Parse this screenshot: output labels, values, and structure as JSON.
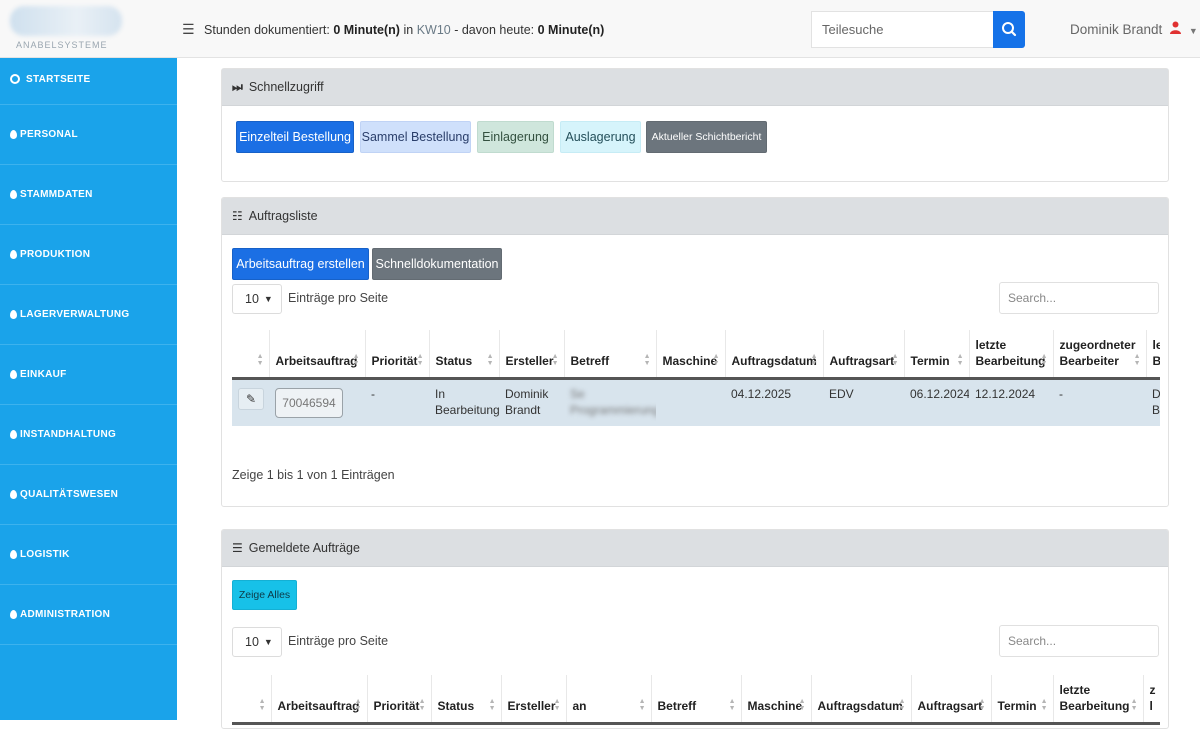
{
  "header": {
    "logo_text": "ANABELSYSTEME",
    "hours_prefix": "Stunden dokumentiert:",
    "hours_value": "0 Minute(n)",
    "hours_in": "in",
    "week": "KW10",
    "today_prefix": "- davon heute:",
    "today_value": "0 Minute(n)",
    "part_search_placeholder": "Teilesuche",
    "user_name": "Dominik Brandt"
  },
  "sidebar": {
    "items": [
      {
        "label": "STARTSEITE"
      },
      {
        "label": "PERSONAL"
      },
      {
        "label": "STAMMDATEN"
      },
      {
        "label": "PRODUKTION"
      },
      {
        "label": "LAGERVERWALTUNG"
      },
      {
        "label": "EINKAUF"
      },
      {
        "label": "INSTANDHALTUNG"
      },
      {
        "label": "QUALITÄTSWESEN"
      },
      {
        "label": "LOGISTIK"
      },
      {
        "label": "ADMINISTRATION"
      }
    ]
  },
  "quick_access": {
    "title": "Schnellzugriff",
    "buttons": [
      "Einzelteil Bestellung",
      "Sammel Bestellung",
      "Einlagerung",
      "Auslagerung",
      "Aktueller Schichtbericht"
    ]
  },
  "order_list": {
    "title": "Auftragsliste",
    "create_button": "Arbeitsauftrag erstellen",
    "quick_doc_button": "Schnelldokumentation",
    "page_length": "10",
    "page_length_label": "Einträge pro Seite",
    "search_placeholder": "Search...",
    "columns": [
      "Arbeitsauftrag",
      "Priorität",
      "Status",
      "Ersteller",
      "Betreff",
      "Maschine",
      "Auftragsdatum",
      "Auftragsart",
      "Termin",
      "letzte Bearbeitung",
      "zugeordneter Bearbeiter",
      "le B"
    ],
    "row": {
      "order_no": "70046594",
      "priority": "-",
      "status_line1": "In",
      "status_line2": "Bearbeitung",
      "creator_line1": "Dominik",
      "creator_line2": "Brandt",
      "subject_line1": "Se",
      "subject_line2": "Programmierung",
      "machine": "",
      "order_date": "04.12.2025",
      "order_type": "EDV",
      "due_date": "06.12.2024",
      "last_edit": "12.12.2024",
      "assignee": "-",
      "extra_line1": "D",
      "extra_line2": "B"
    },
    "info": "Zeige 1 bis 1 von 1 Einträgen"
  },
  "reported_orders": {
    "title": "Gemeldete Aufträge",
    "show_all_button": "Zeige Alles",
    "page_length": "10",
    "page_length_label": "Einträge pro Seite",
    "search_placeholder": "Search...",
    "columns": [
      "Arbeitsauftrag",
      "Priorität",
      "Status",
      "Ersteller",
      "an",
      "Betreff",
      "Maschine",
      "Auftragsdatum",
      "Auftragsart",
      "Termin",
      "letzte Bearbeitung",
      "z l"
    ]
  },
  "colors": {
    "sidebar": "#1aa3ea",
    "primary": "#1b6fe4",
    "status_in_progress": "#f2b705",
    "due_overdue": "#e19aa0",
    "row_highlight": "#d8e4ed"
  }
}
